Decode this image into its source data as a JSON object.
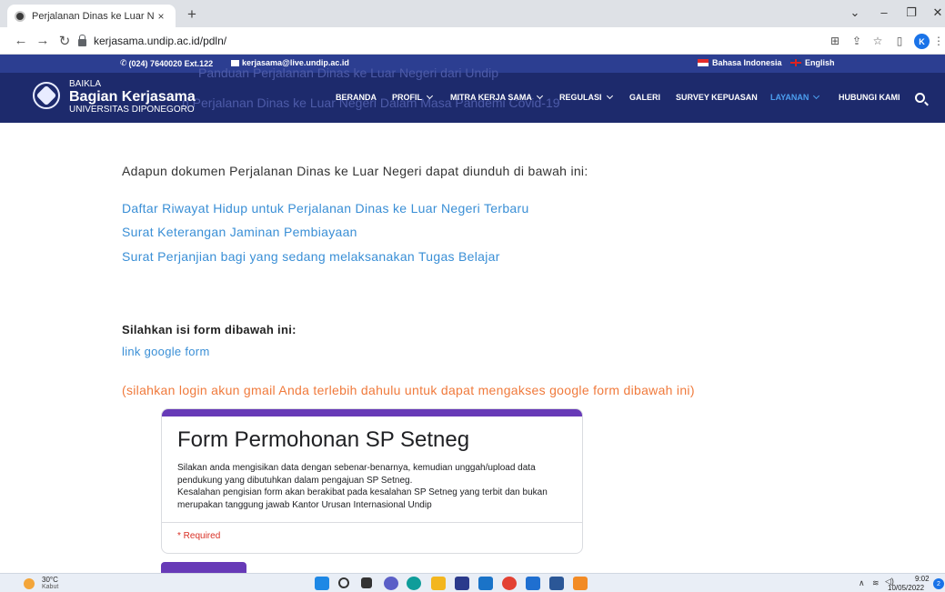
{
  "browser": {
    "tab_title": "Perjalanan Dinas ke Luar Negeri",
    "tab_close": "×",
    "new_tab": "+",
    "url": "kerjasama.undip.ac.id/pdln/",
    "window_controls": [
      "⌄",
      "–",
      "❐",
      "✕"
    ],
    "profile_initial": "K"
  },
  "site_topbar": {
    "phone": "(024) 7640020 Ext.122",
    "email": "kerjasama@live.undip.ac.id",
    "lang_id": "Bahasa Indonesia",
    "lang_en": "English"
  },
  "header": {
    "brand_small": "BAIKLA",
    "brand_title": "Bagian Kerjasama",
    "brand_subtitle": "UNIVERSITAS DIPONEGORO",
    "ghost_line_1": "Panduan Perjalanan Dinas ke Luar Negeri dari Undip",
    "ghost_line_2": "n Perjalanan Dinas ke Luar Negeri Dalam Masa Pandemi Covid-19",
    "nav": [
      {
        "label": "BERANDA",
        "dropdown": false
      },
      {
        "label": "PROFIL",
        "dropdown": true
      },
      {
        "label": "MITRA KERJA SAMA",
        "dropdown": true
      },
      {
        "label": "REGULASI",
        "dropdown": true
      },
      {
        "label": "GALERI",
        "dropdown": false
      },
      {
        "label": "SURVEY KEPUASAN",
        "dropdown": false
      },
      {
        "label": "LAYANAN",
        "dropdown": true,
        "active": true
      },
      {
        "label": "HUBUNGI KAMI",
        "dropdown": false
      }
    ]
  },
  "content": {
    "intro": "Adapun dokumen Perjalanan Dinas ke Luar Negeri dapat diunduh di bawah ini:",
    "doc_links": [
      "Daftar Riwayat Hidup untuk Perjalanan Dinas ke Luar Negeri Terbaru",
      "Surat Keterangan Jaminan Pembiayaan",
      "Surat Perjanjian bagi yang sedang melaksanakan Tugas Belajar"
    ],
    "form_heading": "Silahkan isi form dibawah ini:",
    "gform_link": "link google form",
    "login_note": "(silahkan login akun gmail Anda terlebih dahulu untuk dapat mengakses google form dibawah ini)"
  },
  "gform": {
    "title": "Form Permohonan SP Setneg",
    "desc_1": "Silakan anda mengisikan data dengan sebenar-benarnya, kemudian unggah/upload data pendukung yang dibutuhkan dalam pengajuan SP Setneg.",
    "desc_2": "Kesalahan pengisian form akan berakibat pada kesalahan SP Setneg yang terbit dan bukan merupakan tanggung jawab Kantor Urusan Internasional Undip",
    "required": "* Required"
  },
  "taskbar": {
    "temp": "30°C",
    "condition": "Kabut",
    "time": "9:02",
    "date": "10/05/2022",
    "notifications": "2"
  },
  "colors": {
    "topbar": "#2c3e91",
    "header": "#1d2a6c",
    "link": "#3a8fd6",
    "note": "#f07a3c",
    "gform_accent": "#673ab7",
    "active_nav": "#4c9ff0"
  }
}
